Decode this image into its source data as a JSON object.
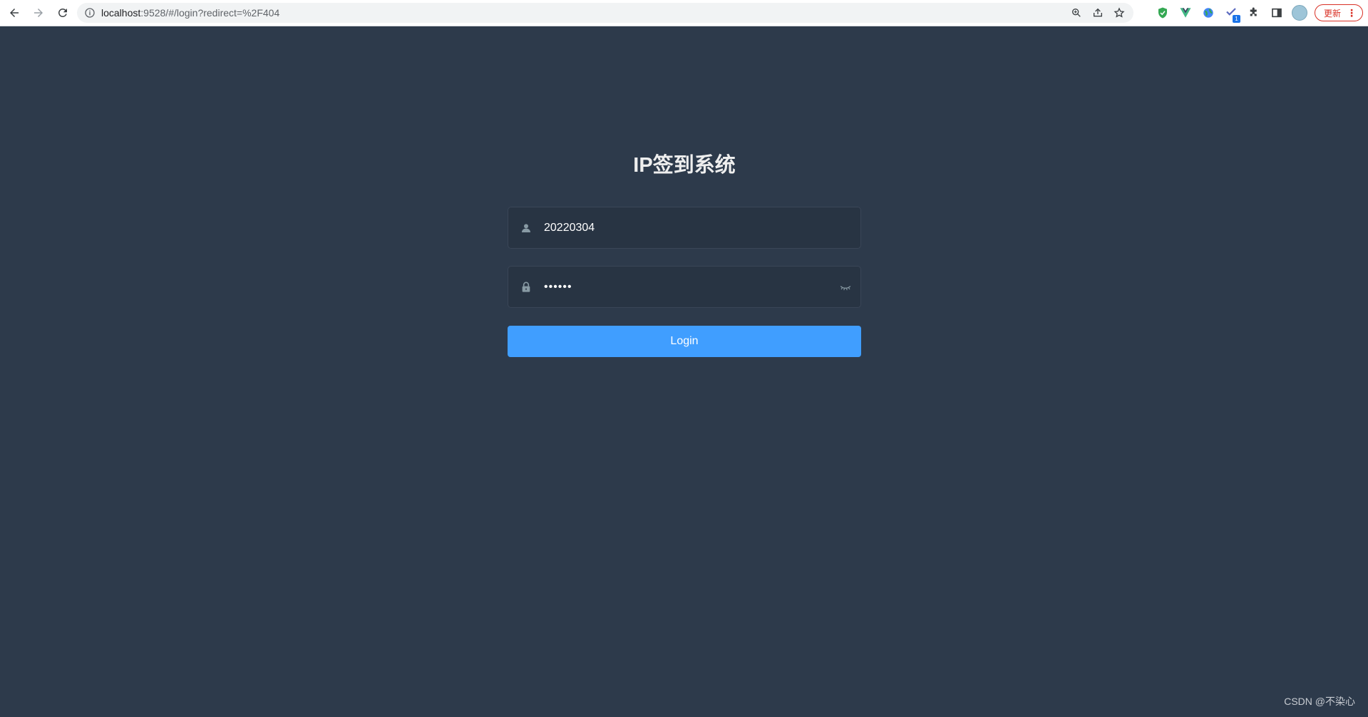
{
  "browser": {
    "url_host": "localhost",
    "url_path": ":9528/#/login?redirect=%2F404",
    "update_label": "更新",
    "extension_badge": "1"
  },
  "login": {
    "title": "IP签到系统",
    "username_value": "20220304",
    "password_value": "••••••",
    "button_label": "Login"
  },
  "watermark": "CSDN @不染心",
  "colors": {
    "background": "#2d3a4b",
    "field": "#283443",
    "button": "#409eff",
    "title": "#eeeeee"
  }
}
